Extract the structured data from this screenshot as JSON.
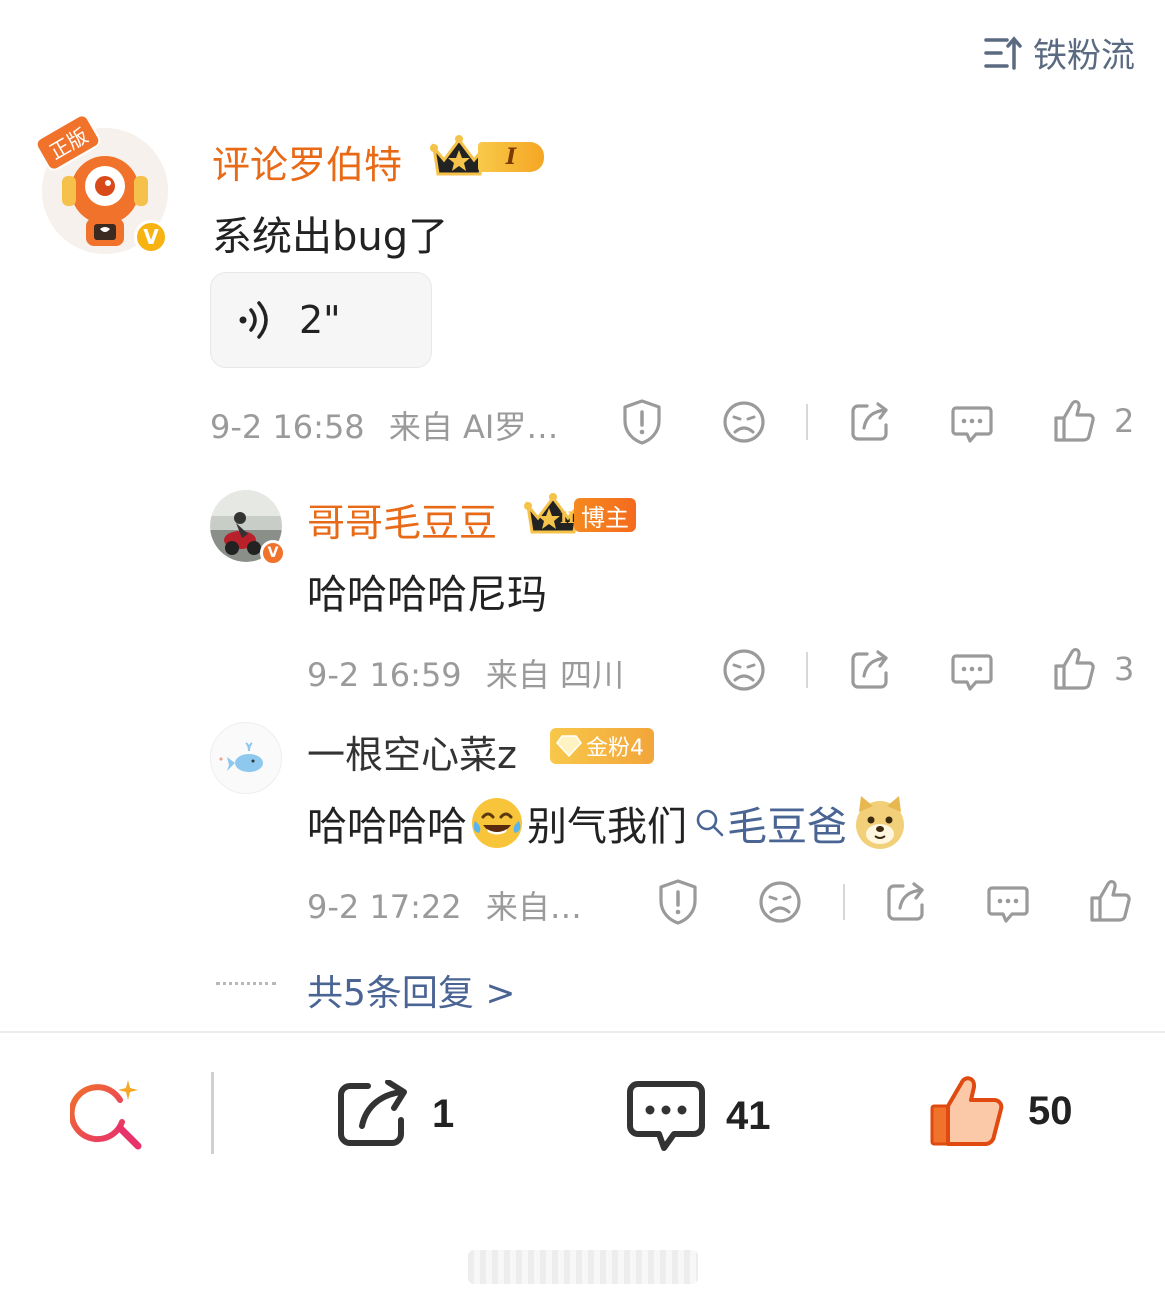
{
  "header": {
    "sort_label": "铁粉流"
  },
  "comment": {
    "avatar_badge": "正版",
    "author": "评论罗伯特",
    "crown_level": "I",
    "text": "系统出bug了",
    "voice_duration": "2\"",
    "timestamp": "9-2 16:58",
    "source": "来自 AI罗…",
    "like_count": "2"
  },
  "replies": [
    {
      "author": "哥哥毛豆豆",
      "crown_level": "II",
      "role_badge": "博主",
      "text": "哈哈哈哈尼玛",
      "timestamp": "9-2 16:59",
      "source": "来自 四川",
      "like_count": "3"
    },
    {
      "author": "一根空心菜z",
      "fan_badge": "金粉4",
      "text_prefix": "哈哈哈哈",
      "text_middle": "别气我们",
      "mention": "毛豆爸",
      "timestamp": "9-2 17:22",
      "source": "来自…"
    }
  ],
  "more_replies": "共5条回复 >",
  "bottom_bar": {
    "share_count": "1",
    "comment_count": "41",
    "like_count": "50"
  },
  "colors": {
    "accent_orange": "#e86a17",
    "link_blue": "#4a6494",
    "icon_gray": "#9a9a9a",
    "like_orange": "#f0722b"
  }
}
